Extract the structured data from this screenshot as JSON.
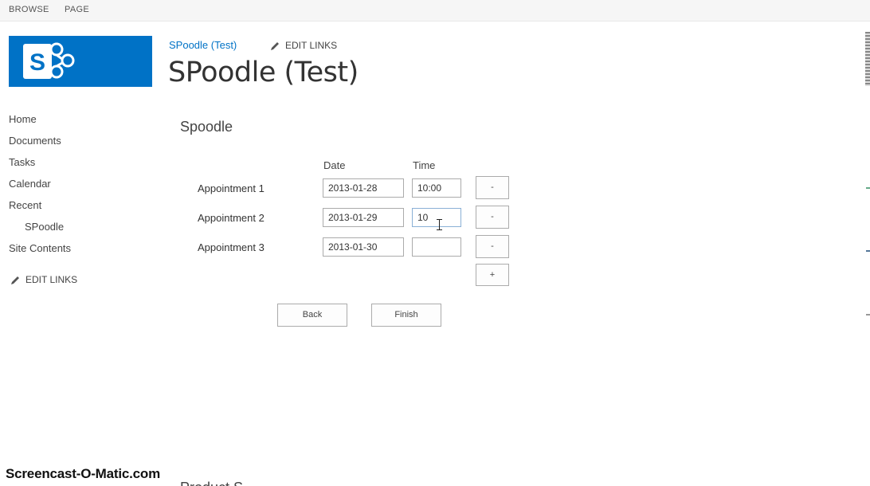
{
  "ribbon": {
    "tabs": [
      "BROWSE",
      "PAGE"
    ]
  },
  "site": {
    "breadcrumb": "SPoodle (Test)",
    "edit_links": "EDIT LINKS",
    "title": "SPoodle (Test)",
    "logo_icon": "sharepoint-logo-icon",
    "brand_color": "#0072c6"
  },
  "nav": {
    "items": [
      "Home",
      "Documents",
      "Tasks",
      "Calendar",
      "Recent"
    ],
    "sub_item": "SPoodle",
    "site_contents": "Site Contents",
    "edit_links": "EDIT LINKS"
  },
  "form": {
    "heading": "Spoodle",
    "col_date": "Date",
    "col_time": "Time",
    "rows": [
      {
        "label": "Appointment 1",
        "date": "2013-01-28",
        "time": "10:00",
        "remove": "-"
      },
      {
        "label": "Appointment 2",
        "date": "2013-01-29",
        "time": "10",
        "remove": "-"
      },
      {
        "label": "Appointment 3",
        "date": "2013-01-30",
        "time": "",
        "remove": "-"
      }
    ],
    "add": "+",
    "back": "Back",
    "finish": "Finish"
  },
  "watermark": "Screencast-O-Matic.com",
  "below_fold_partial": "Product S..."
}
